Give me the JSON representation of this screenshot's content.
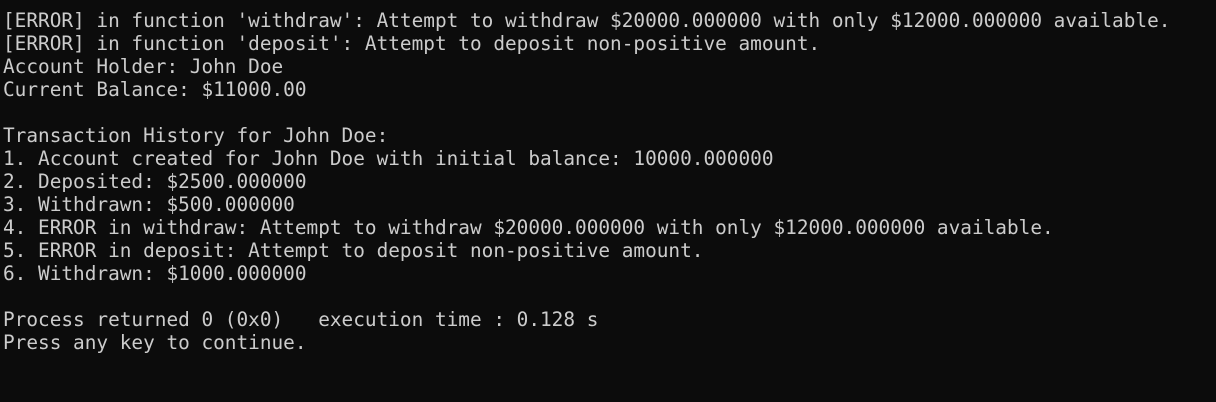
{
  "terminal": {
    "error_lines": [
      "[ERROR] in function 'withdraw': Attempt to withdraw $20000.000000 with only $12000.000000 available.",
      "[ERROR] in function 'deposit': Attempt to deposit non-positive amount."
    ],
    "account_holder": "Account Holder: John Doe",
    "current_balance": "Current Balance: $11000.00",
    "history_title": "Transaction History for John Doe:",
    "history": [
      "1. Account created for John Doe with initial balance: 10000.000000",
      "2. Deposited: $2500.000000",
      "3. Withdrawn: $500.000000",
      "4. ERROR in withdraw: Attempt to withdraw $20000.000000 with only $12000.000000 available.",
      "5. ERROR in deposit: Attempt to deposit non-positive amount.",
      "6. Withdrawn: $1000.000000"
    ],
    "process_status": "Process returned 0 (0x0)   execution time : 0.128 s",
    "continue_prompt": "Press any key to continue."
  },
  "colors": {
    "background": "#0c0c0c",
    "text": "#cccccc"
  }
}
